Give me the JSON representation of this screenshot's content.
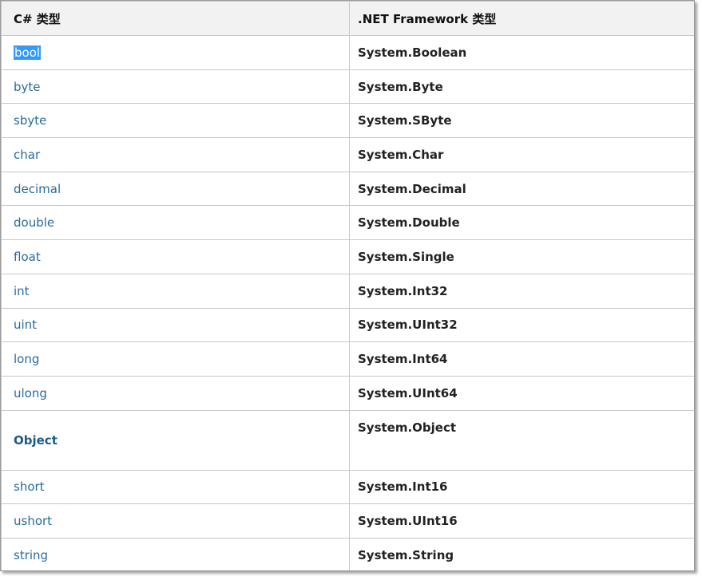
{
  "table": {
    "headers": [
      "C# 类型",
      ".NET Framework 类型"
    ],
    "rows": [
      {
        "cs": "bool",
        "net": "System.Boolean",
        "selected": true
      },
      {
        "cs": "byte",
        "net": "System.Byte"
      },
      {
        "cs": "sbyte",
        "net": "System.SByte"
      },
      {
        "cs": "char",
        "net": "System.Char"
      },
      {
        "cs": "decimal",
        "net": "System.Decimal"
      },
      {
        "cs": "double",
        "net": "System.Double"
      },
      {
        "cs": "float",
        "net": "System.Single"
      },
      {
        "cs": "int",
        "net": "System.Int32"
      },
      {
        "cs": "uint",
        "net": "System.UInt32"
      },
      {
        "cs": "long",
        "net": "System.Int64"
      },
      {
        "cs": "ulong",
        "net": "System.UInt64"
      },
      {
        "cs": "Object",
        "net": "System.Object",
        "bold": true
      },
      {
        "cs": "short",
        "net": "System.Int16"
      },
      {
        "cs": "ushort",
        "net": "System.UInt16"
      },
      {
        "cs": "string",
        "net": "System.String"
      }
    ]
  },
  "colors": {
    "link": "#2a6b9a",
    "selection": "#3399ff",
    "header_bg": "#f2f2f2"
  }
}
